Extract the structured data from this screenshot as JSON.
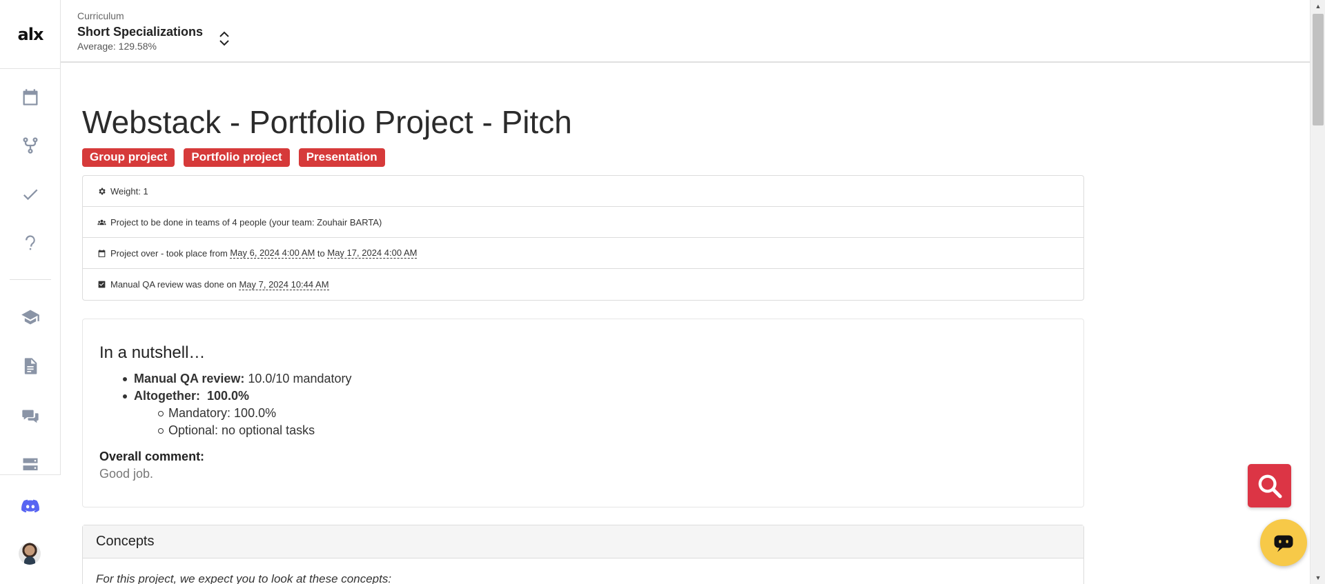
{
  "sidebar": {
    "logo": "alx",
    "items": [
      {
        "name": "calendar-icon"
      },
      {
        "name": "fork-icon"
      },
      {
        "name": "check-icon"
      },
      {
        "name": "question-icon"
      },
      {
        "name": "graduation-cap-icon"
      },
      {
        "name": "document-icon"
      },
      {
        "name": "chat-icon"
      },
      {
        "name": "server-icon"
      }
    ],
    "bottom": [
      {
        "name": "discord-icon"
      },
      {
        "name": "avatar"
      }
    ],
    "icon_color": "#8a94a6",
    "discord_color": "#5865f2"
  },
  "header": {
    "label": "Curriculum",
    "title": "Short Specializations",
    "average": "Average: 129.58%"
  },
  "page": {
    "title": "Webstack - Portfolio Project - Pitch",
    "tags": [
      "Group project",
      "Portfolio project",
      "Presentation"
    ],
    "tag_color": "#d63a3a"
  },
  "info": {
    "weight": "Weight: 1",
    "team": "Project to be done in teams of 4 people (your team: Zouhair BARTA)",
    "period_prefix": "Project over - took place from",
    "period_start": "May 6, 2024 4:00 AM",
    "period_to": "to",
    "period_end": "May 17, 2024 4:00 AM",
    "review_prefix": "Manual QA review was done on",
    "review_date": "May 7, 2024 10:44 AM"
  },
  "nutshell": {
    "title": "In a nutshell…",
    "manual_label": "Manual QA review:",
    "manual_value": "10.0/10 mandatory",
    "altogether_label": "Altogether:",
    "altogether_value": "100.0%",
    "mandatory": "Mandatory: 100.0%",
    "optional": "Optional: no optional tasks",
    "overall_label": "Overall comment:",
    "overall_text": "Good job."
  },
  "concepts": {
    "title": "Concepts",
    "intro": "For this project, we expect you to look at these concepts:"
  },
  "fabs": {
    "search_color": "#dc3545",
    "chat_color": "#f7c948"
  }
}
